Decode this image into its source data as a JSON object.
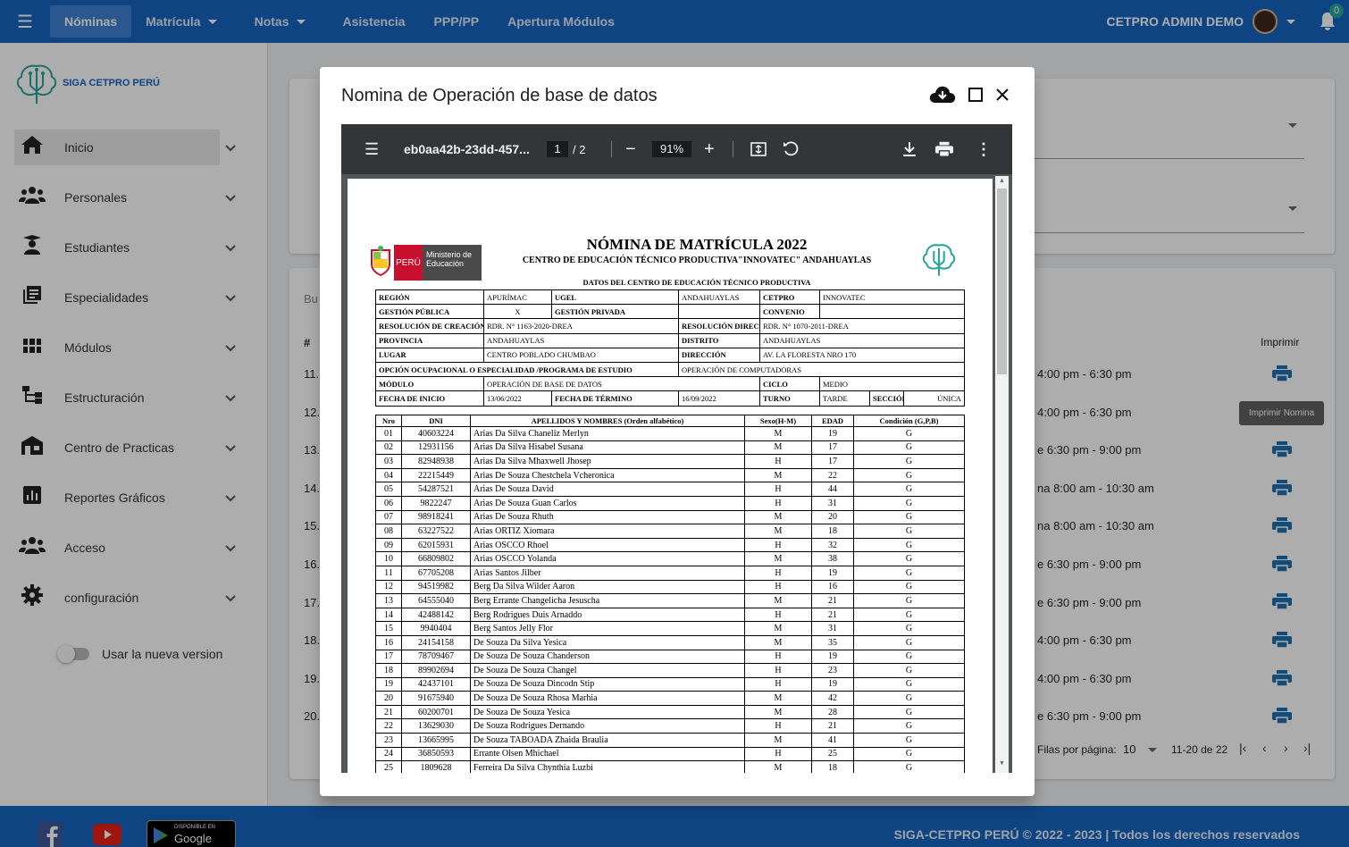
{
  "topbar": {
    "nav": [
      "Nóminas",
      "Matrícula",
      "Notas",
      "Asistencia",
      "PPP/PP",
      "Apertura Módulos"
    ],
    "user": "CETPRO ADMIN DEMO",
    "notifications": "0"
  },
  "sidebar": {
    "logo": "SIGA CETPRO PERÚ",
    "items": [
      "Inicio",
      "Personales",
      "Estudiantes",
      "Especialidades",
      "Módulos",
      "Estructuración",
      "Centro de Practicas",
      "Reportes Gráficos",
      "Acceso",
      "configuración"
    ],
    "toggle_label": "Usar la nueva version"
  },
  "background": {
    "search_label": "Bu",
    "col_num": "#",
    "col_print": "Imprimir",
    "tooltip": "Imprimir Nomina",
    "rows": [
      {
        "n": "11.",
        "time": "4:00 pm - 6:30 pm"
      },
      {
        "n": "12.",
        "time": "4:00 pm - 6:30 pm"
      },
      {
        "n": "13.",
        "time": "e 6:30 pm - 9:00 pm"
      },
      {
        "n": "14.",
        "time": "na 8:00 am - 10:30 am"
      },
      {
        "n": "15.",
        "time": "na 8:00 am - 10:30 am"
      },
      {
        "n": "16.",
        "time": "e 6:30 pm - 9:00 pm"
      },
      {
        "n": "17.",
        "time": "e 6:30 pm - 9:00 pm"
      },
      {
        "n": "18.",
        "time": "4:00 pm - 6:30 pm"
      },
      {
        "n": "19.",
        "time": "4:00 pm - 6:30 pm"
      },
      {
        "n": "20.",
        "time": "e 6:30 pm - 9:00 pm"
      }
    ],
    "pagination": {
      "rows_label": "Filas por página:",
      "rows_value": "10",
      "range": "11-20 de 22"
    }
  },
  "modal": {
    "title": "Nomina de Operación de base de datos",
    "viewer": {
      "filename": "eb0aa42b-23dd-457...",
      "page": "1",
      "total": "/  2",
      "zoom": "91%"
    }
  },
  "document": {
    "ministry": "Ministerio de Educación",
    "peru": "PERÚ",
    "title": "NÓMINA DE MATRÍCULA 2022",
    "subtitle": "CENTRO DE EDUCACIÓN TÉCNICO PRODUCTIVA\"INNOVATEC\" ANDAHUAYLAS",
    "section": "DATOS DEL CENTRO DE EDUCACIÓN TÉCNICO PRODUCTIVA",
    "info": {
      "region_l": "REGIÓN",
      "region": "APURÍMAC",
      "ugel_l": "UGEL",
      "ugel": "ANDAHUAYLAS",
      "cetpro_l": "CETPRO",
      "cetpro": "INNOVATEC",
      "gp_l": "GESTIÓN PÚBLICA",
      "gp": "X",
      "gpriv_l": "GESTIÓN PRIVADA",
      "conv_l": "CONVENIO",
      "rc_l": "RESOLUCIÓN DE CREACIÓN",
      "rc": "RDR. N° 1163-2020-DREA",
      "rd_l": "RESOLUCIÓN DIRECTORAL",
      "rd": "RDR. N° 1070-2011-DREA",
      "prov_l": "PROVINCIA",
      "prov": "ANDAHUAYLAS",
      "dist_l": "DISTRITO",
      "dist": "ANDAHUAYLAS",
      "lugar_l": "LUGAR",
      "lugar": "CENTRO POBLADO CHUMBAO",
      "dir_l": "DIRECCIÓN",
      "dir": "AV. LA FLORESTA NRO 170",
      "op_l": "OPCIÓN OCUPACIONAL O ESPECIALIDAD /PROGRAMA DE ESTUDIO",
      "op": "OPERACIÓN DE COMPUTADORAS",
      "mod_l": "MÓDULO",
      "mod": "OPERACIÓN DE BASE DE DATOS",
      "ciclo_l": "CICLO",
      "ciclo": "MEDIO",
      "fi_l": "FECHA DE INICIO",
      "fi": "13/06/2022",
      "ft_l": "FECHA DE TÉRMINO",
      "ft": "16/09/2022",
      "turno_l": "TURNO",
      "turno": "TARDE",
      "secc_l": "SECCIÓN",
      "secc": "ÚNICA"
    },
    "headers": [
      "Nro",
      "DNI",
      "APELLIDOS Y NOMBRES (Orden alfabético)",
      "Sexo(H-M)",
      "EDAD",
      "Condición (G,P,B)"
    ],
    "students": [
      [
        "01",
        "40603224",
        "Arias Da Silva Chaneliz Merlyn",
        "M",
        "19",
        "G"
      ],
      [
        "02",
        "12931156",
        "Arias Da Silva Hisabel Susana",
        "M",
        "17",
        "G"
      ],
      [
        "03",
        "82948938",
        "Arias Da Silva Mhaxwell Jhosep",
        "H",
        "17",
        "G"
      ],
      [
        "04",
        "22215449",
        "Arias De Souza Chestchela Vcheronica",
        "M",
        "22",
        "G"
      ],
      [
        "05",
        "54287521",
        "Arias De Souza David",
        "H",
        "44",
        "G"
      ],
      [
        "06",
        "9822247",
        "Arias De Souza Guan Carlos",
        "H",
        "31",
        "G"
      ],
      [
        "07",
        "98918241",
        "Arias De Souza Rhuth",
        "M",
        "20",
        "G"
      ],
      [
        "08",
        "63227522",
        "Arias ORTIZ Xiomara",
        "M",
        "18",
        "G"
      ],
      [
        "09",
        "62015931",
        "Arias OSCCO Rhoel",
        "H",
        "32",
        "G"
      ],
      [
        "10",
        "66809802",
        "Arias OSCCO Yolanda",
        "M",
        "38",
        "G"
      ],
      [
        "11",
        "67705208",
        "Arias Santos Jilber",
        "H",
        "19",
        "G"
      ],
      [
        "12",
        "94519982",
        "Berg Da Silva Wilder Aaron",
        "H",
        "16",
        "G"
      ],
      [
        "13",
        "64555040",
        "Berg Errante Changelicha Jesuscha",
        "M",
        "21",
        "G"
      ],
      [
        "14",
        "42488142",
        "Berg Rodrigues Duis Arnaddo",
        "H",
        "21",
        "G"
      ],
      [
        "15",
        "9940404",
        "Berg Santos Jelly Flor",
        "M",
        "31",
        "G"
      ],
      [
        "16",
        "24154158",
        "De Souza Da Silva Yesica",
        "M",
        "35",
        "G"
      ],
      [
        "17",
        "78709467",
        "De Souza De Souza Chanderson",
        "H",
        "19",
        "G"
      ],
      [
        "18",
        "89902694",
        "De Souza De Souza Changel",
        "H",
        "23",
        "G"
      ],
      [
        "19",
        "42437101",
        "De Souza De Souza Dincodn Stip",
        "H",
        "19",
        "G"
      ],
      [
        "20",
        "91675940",
        "De Souza De Souza Rhosa Marhia",
        "M",
        "42",
        "G"
      ],
      [
        "21",
        "60200701",
        "De Souza De Souza Yesica",
        "M",
        "28",
        "G"
      ],
      [
        "22",
        "13629030",
        "De Souza Rodrigues Dernando",
        "H",
        "21",
        "G"
      ],
      [
        "23",
        "13665995",
        "De Souza TABOADA Zhaida Braulia",
        "M",
        "41",
        "G"
      ],
      [
        "24",
        "36850593",
        "Errante Olsen Mhichael",
        "H",
        "25",
        "G"
      ],
      [
        "25",
        "1809628",
        "Ferreira Da Silva Chynthia Luzbi",
        "M",
        "18",
        "G"
      ]
    ]
  },
  "footer": {
    "copyright": "SIGA-CETPRO PERÚ © 2022 - 2023 | Todos los derechos reservados",
    "gp_small": "DISPONIBLE EN",
    "gp_big": "Google Play"
  },
  "colors": {
    "primary": "#1565c0",
    "accent": "#26a69a",
    "print_icon": "#1e6fb0"
  }
}
